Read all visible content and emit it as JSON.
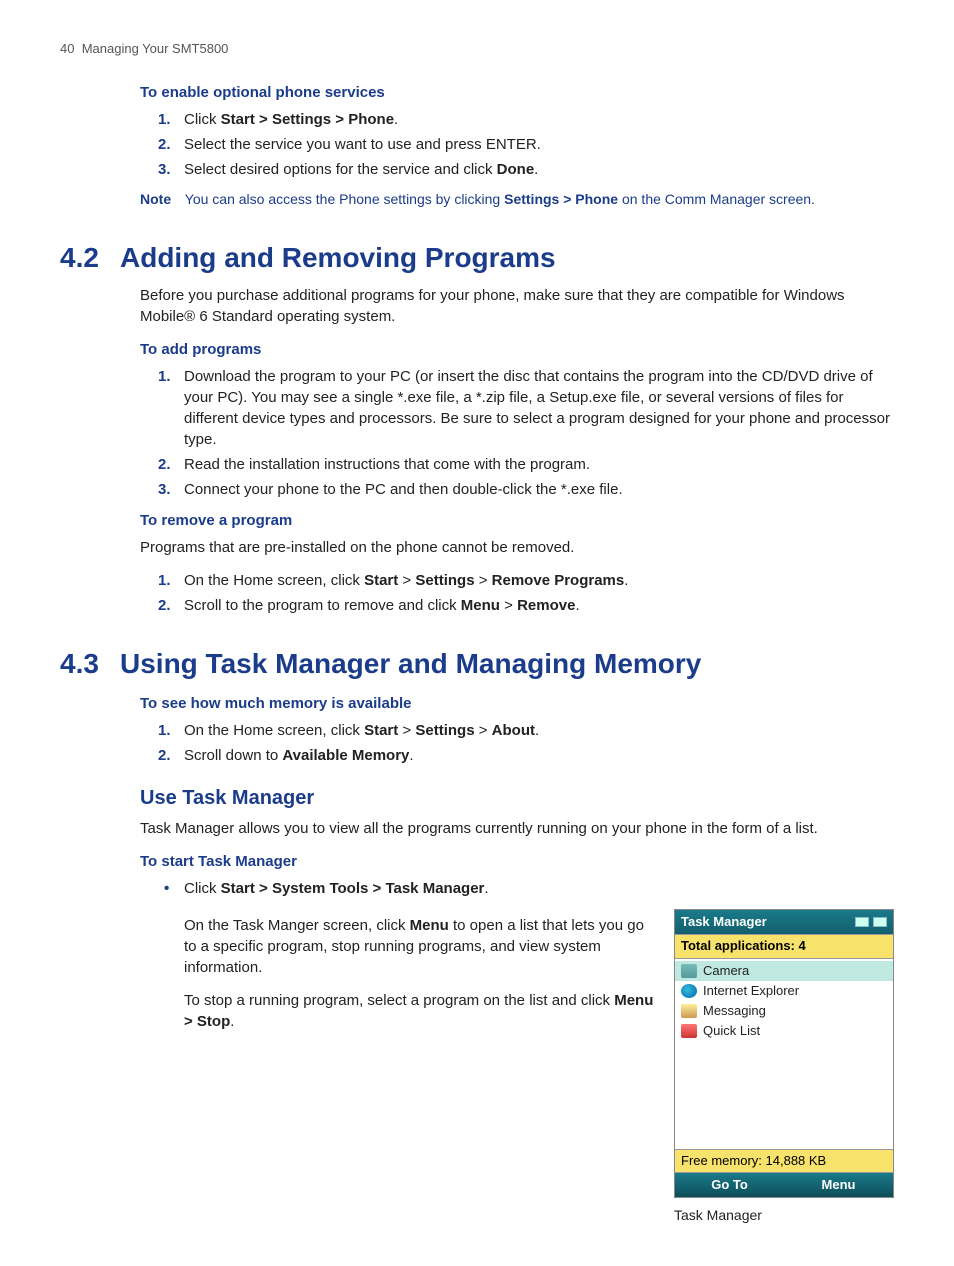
{
  "header": {
    "page_num": "40",
    "chapter": "Managing Your SMT5800"
  },
  "sec_services": {
    "h": "To enable optional phone services",
    "steps": [
      {
        "pre": "Click ",
        "bold": "Start > Settings > Phone",
        "post": "."
      },
      {
        "pre": "Select the service you want to use and press ENTER.",
        "bold": "",
        "post": ""
      },
      {
        "pre": "Select desired options for the service and click ",
        "bold": "Done",
        "post": "."
      }
    ],
    "note_label": "Note",
    "note_pre": "You can also access the Phone settings by clicking ",
    "note_bold": "Settings > Phone",
    "note_post": " on the Comm Manager screen."
  },
  "sec42": {
    "num": "4.2",
    "title": "Adding and Removing Programs",
    "intro": "Before you purchase additional programs for your phone, make sure that they are compatible for Windows Mobile® 6 Standard operating system.",
    "add_h": "To add programs",
    "add_steps": [
      "Download the program to your PC (or insert the disc that contains the program into the CD/DVD drive of your PC). You may see a single *.exe file, a *.zip file, a Setup.exe file, or several versions of files for different device types and processors. Be sure to select a program designed for your phone and processor type.",
      "Read the installation instructions that come with the program.",
      "Connect your phone to the PC and then double-click the *.exe file."
    ],
    "rem_h": "To remove a program",
    "rem_intro": "Programs that are pre-installed on the phone cannot be removed.",
    "rem_steps": [
      {
        "parts": [
          "On the Home screen, click ",
          "Start",
          " > ",
          "Settings",
          " > ",
          "Remove Programs",
          "."
        ]
      },
      {
        "parts": [
          "Scroll to the program to remove and click ",
          "Menu",
          " > ",
          "Remove",
          "."
        ]
      }
    ]
  },
  "sec43": {
    "num": "4.3",
    "title": "Using Task Manager and Managing Memory",
    "mem_h": "To see how much memory is available",
    "mem_steps": [
      {
        "parts": [
          "On the Home screen, click ",
          "Start",
          " > ",
          "Settings",
          " > ",
          "About",
          "."
        ]
      },
      {
        "parts": [
          "Scroll down to ",
          "Available Memory",
          "."
        ]
      }
    ],
    "tm_h2": "Use Task Manager",
    "tm_intro": "Task Manager allows you to view all the programs currently running on your phone in the form of a list.",
    "start_h": "To start Task Manager",
    "bullet_pre": "Click ",
    "bullet_bold": "Start > System Tools > Task Manager",
    "bullet_post": ".",
    "para1_a": "On the Task Manger screen, click ",
    "para1_b": "Menu",
    "para1_c": " to open a list that lets you go to a specific program, stop running programs, and view system information.",
    "para2_a": "To stop a running program, select a program on the list and click ",
    "para2_b": "Menu > Stop",
    "para2_c": "."
  },
  "screenshot": {
    "title": "Task Manager",
    "total": "Total applications: 4",
    "apps": [
      "Camera",
      "Internet Explorer",
      "Messaging",
      "Quick List"
    ],
    "free": "Free memory: 14,888 KB",
    "left_key": "Go To",
    "right_key": "Menu",
    "caption": "Task Manager"
  }
}
